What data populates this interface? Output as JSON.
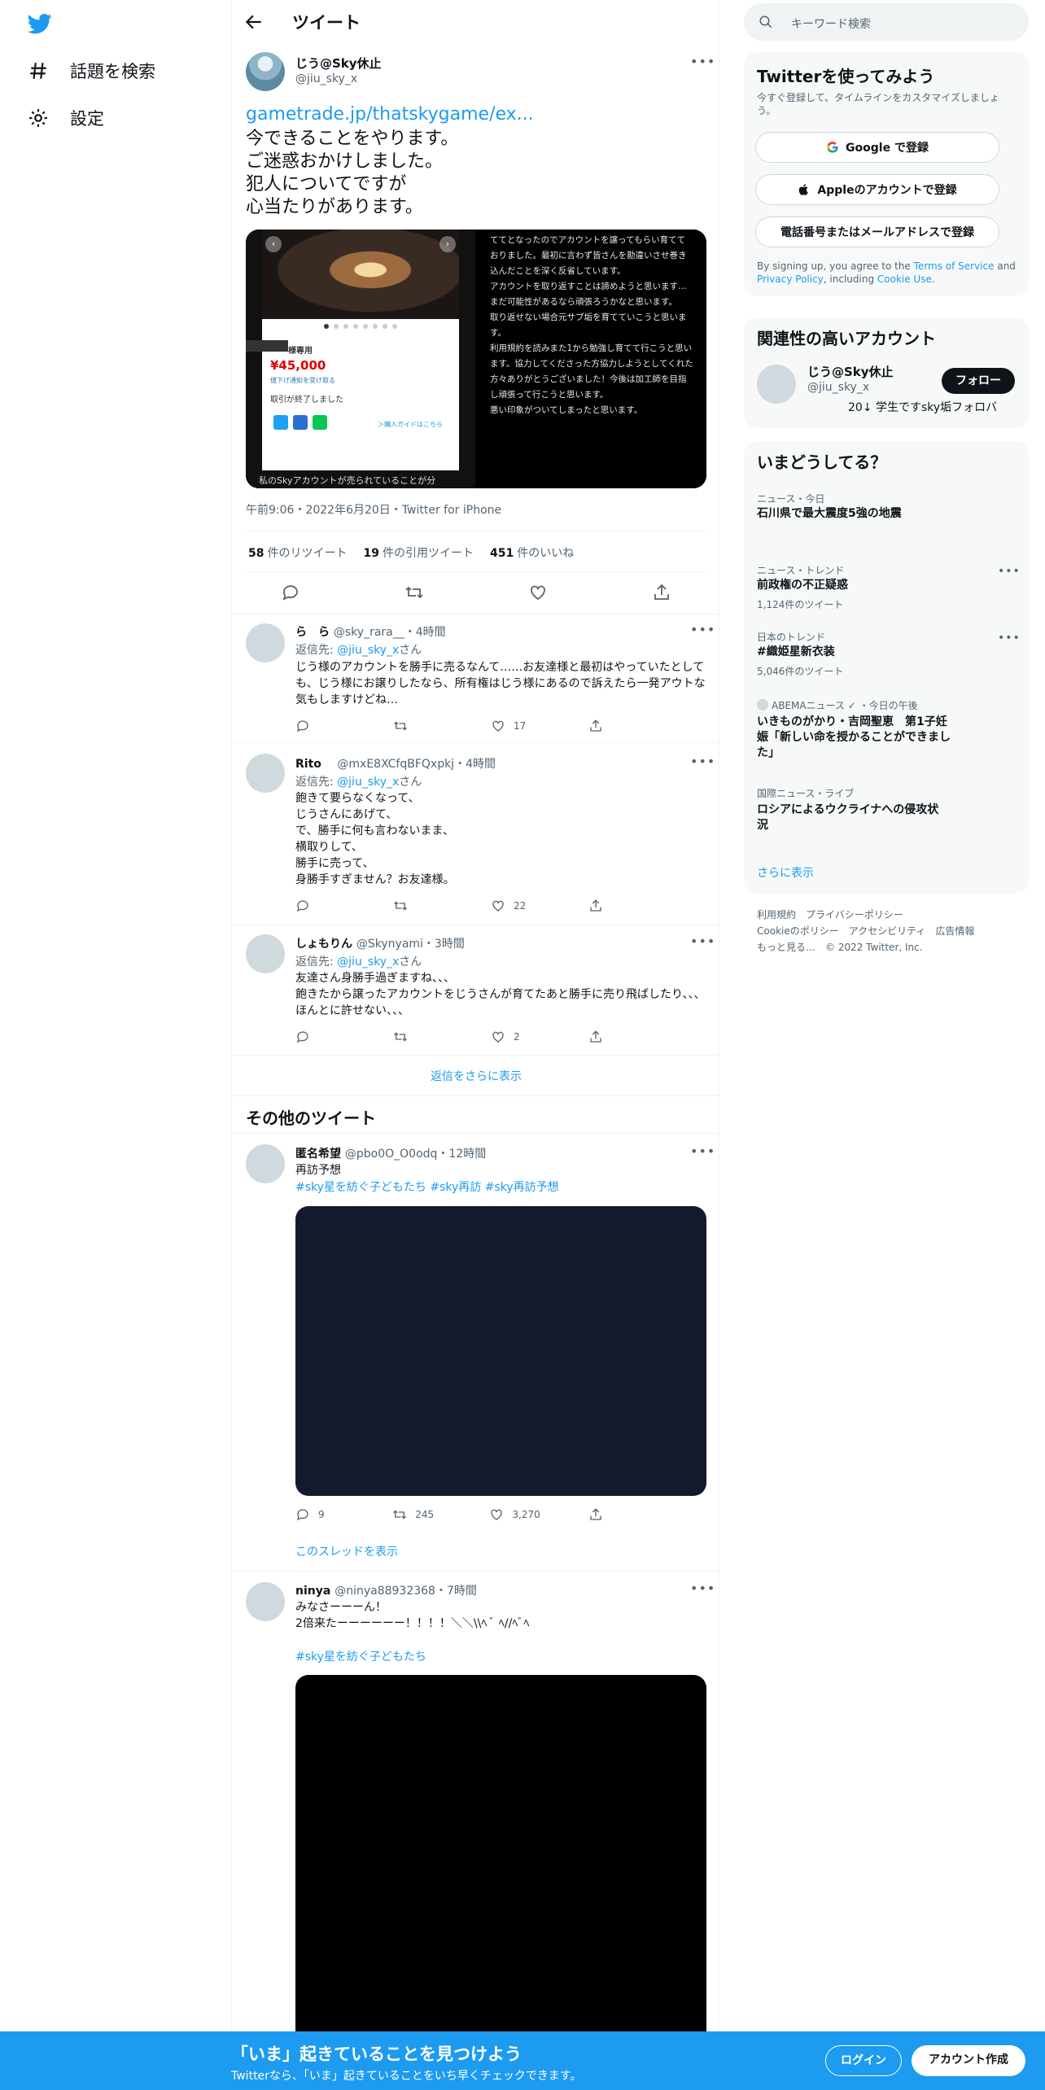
{
  "nav": {
    "explore_label": "話題を検索",
    "settings_label": "設定"
  },
  "header": {
    "title": "ツイート"
  },
  "main_tweet": {
    "name": "じう@Sky休止",
    "handle": "@jiu_sky_x",
    "link": "gametrade.jp/thatskygame/ex...",
    "text": "今できることをやります。\nご迷惑おかけしました。\n犯人についてですが\n心当たりがあります。",
    "media_left": {
      "label_tag": "様専用",
      "price": "¥45,000",
      "note": "値下げ通知を受け取る",
      "status": "取引が終了しました",
      "guide": "＞購入ガイドはこちら",
      "caption": "私のSkyアカウントが売られていることが分"
    },
    "media_right_text": "ててとなったのでアカウントを譲ってもらい育てておりました。最初に言わず皆さんを勘違いさせ巻き込んだことを深く反省しています。\nアカウントを取り返すことは諦めようと思います…まだ可能性があるなら頑張ろうかなと思います。\n取り返せない場合元サブ垢を育てていこうと思います。\n利用規約を読みまた1から勉強し育てて行こうと思います。協力してくださった方協力しようとしてくれた方々ありがとうございました！今後は加工師を目指し頑張って行こうと思います。\n悪い印象がついてしまったと思います。",
    "meta": "午前9:06・2022年6月20日・Twitter for iPhone",
    "retweets": "58",
    "retweets_label": "件のリツイート",
    "quotes": "19",
    "quotes_label": "件の引用ツイート",
    "likes": "451",
    "likes_label": "件のいいね"
  },
  "replies": [
    {
      "name": "ら　ら",
      "handle": "@sky_rara__",
      "time": "・4時間",
      "to_prefix": "返信先: ",
      "to": "@jiu_sky_x",
      "to_suffix": "さん",
      "text": "じう様のアカウントを勝手に売るなんて……お友達様と最初はやっていたとしても、じう様にお譲りしたなら、所有権はじう様にあるので訴えたら一発アウトな気もしますけどね…",
      "likes": "17"
    },
    {
      "name": "Rito",
      "handle": "@mxE8XCfqBFQxpkj",
      "time": "・4時間",
      "to_prefix": "返信先: ",
      "to": "@jiu_sky_x",
      "to_suffix": "さん",
      "text": "飽きて要らなくなって、\nじうさんにあげて、\nで、勝手に何も言わないまま、\n横取りして、\n勝手に売って、\n身勝手すぎません？お友達様。",
      "likes": "22"
    },
    {
      "name": "しょもりん",
      "handle": "@Skynyami",
      "time": "・3時間",
      "to_prefix": "返信先: ",
      "to": "@jiu_sky_x",
      "to_suffix": "さん",
      "text": "友達さん身勝手過ぎますね、、、\n飽きたから譲ったアカウントをじうさんが育てたあと勝手に売り飛ばしたり、、、ほんとに許せない、、、",
      "likes": "2"
    }
  ],
  "show_more_replies": "返信をさらに表示",
  "other_tweets_title": "その他のツイート",
  "other_tweets": [
    {
      "name": "匿名希望",
      "handle": "@pbo0O_O0odq",
      "time": "・12時間",
      "text": "再訪予想",
      "hashtags": "#sky星を紡ぐ子どもたち #sky再訪 #sky再訪予想",
      "replies": "9",
      "retweets": "245",
      "likes": "3,270",
      "thread_link": "このスレッドを表示"
    },
    {
      "name": "ninya",
      "handle": "@ninya88932368",
      "time": "・7時間",
      "text": "みなさーーーん！\n2倍来たーーーーーー！！！！＼＼\\\\ﾍ ﾞ ﾍ//ﾍﾞﾍ",
      "hashtags": "#sky星を紡ぐ子どもたち"
    }
  ],
  "sidebar": {
    "search_placeholder": "キーワード検索",
    "signup": {
      "title": "Twitterを使ってみよう",
      "subtitle": "今すぐ登録して、タイムラインをカスタマイズしましょう。",
      "google": "Google で登録",
      "apple": "Appleのアカウントで登録",
      "phone": "電話番号またはメールアドレスで登録",
      "legal_1": "By signing up, you agree to the ",
      "terms": "Terms of Service",
      "legal_2": " and ",
      "privacy": "Privacy Policy",
      "legal_3": ", including ",
      "cookie": "Cookie Use",
      "legal_4": "."
    },
    "related": {
      "title": "関連性の高いアカウント",
      "name": "じう@Sky休止",
      "handle": "@jiu_sky_x",
      "bio": "20↓ 学生ですsky垢フォロバ",
      "follow": "フォロー"
    },
    "trends": {
      "title": "いまどうしてる？",
      "items": [
        {
          "category": "ニュース・今日",
          "name": "石川県で最大震度5強の地震",
          "count": ""
        },
        {
          "category": "ニュース・トレンド",
          "name": "前政権の不正疑惑",
          "count": "1,124件のツイート"
        },
        {
          "category": "日本のトレンド",
          "name": "#織姫星新衣装",
          "count": "5,046件のツイート"
        },
        {
          "category": "ABEMAニュース ✓ ・今日の午後",
          "name": "いきものがかり・吉岡聖恵　第1子妊娠「新しい命を授かることができました」",
          "count": ""
        },
        {
          "category": "国際ニュース・ライブ",
          "name": "ロシアによるウクライナへの侵攻状況",
          "count": ""
        }
      ],
      "show_more": "さらに表示"
    },
    "footer": {
      "line1": "利用規約　プライバシーポリシー",
      "line2": "Cookieのポリシー　アクセシビリティ　広告情報",
      "line3": "もっと見る…　© 2022 Twitter, Inc."
    }
  },
  "banner": {
    "title": "「いま」起きていることを見つけよう",
    "subtitle": "Twitterなら、「いま」起きていることをいち早くチェックできます。",
    "login": "ログイン",
    "signup": "アカウント作成"
  },
  "colors": {
    "accent": "#1d9bf0",
    "text": "#0f1419",
    "muted": "#536471"
  }
}
